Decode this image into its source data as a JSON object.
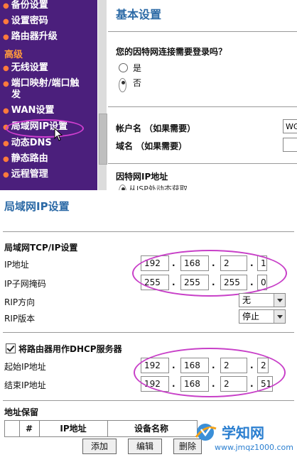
{
  "sidebar": {
    "items_top": [
      {
        "label": "备份设置"
      },
      {
        "label": "设置密码"
      },
      {
        "label": "路由器升级"
      }
    ],
    "section_advanced": "高级",
    "items_adv": [
      {
        "label": "无线设置"
      },
      {
        "label": "端口映射/端口触"
      },
      {
        "label": "发"
      },
      {
        "label": "WAN设置"
      },
      {
        "label": "局域网IP设置"
      },
      {
        "label": "动态DNS"
      },
      {
        "label": "静态路由"
      },
      {
        "label": "远程管理"
      }
    ]
  },
  "basic": {
    "title": "基本设置",
    "question": "您的因特网连接需要登录吗？",
    "opt_yes": "是",
    "opt_no": "否",
    "selected": "否",
    "account_label": "帐户名 （如果需要）",
    "account_value": "WGI",
    "domain_label": "域名 （如果需要）",
    "domain_value": "",
    "isp_title": "因特网IP地址",
    "isp_sub": "从ISP处动态获取"
  },
  "lan": {
    "title": "局域网IP设置",
    "tcpip_title": "局域网TCP/IP设置",
    "ip_label": "IP地址",
    "ip": [
      "192",
      "168",
      "2",
      "1"
    ],
    "mask_label": "IP子网掩码",
    "mask": [
      "255",
      "255",
      "255",
      "0"
    ],
    "rip_dir_label": "RIP方向",
    "rip_dir_value": "无",
    "rip_ver_label": "RIP版本",
    "rip_ver_value": "停止",
    "dhcp_label": "将路由器用作DHCP服务器",
    "dhcp_checked": true,
    "start_label": "起始IP地址",
    "start_ip": [
      "192",
      "168",
      "2",
      "2"
    ],
    "end_label": "结束IP地址",
    "end_ip": [
      "192",
      "168",
      "2",
      "51"
    ],
    "reserve_title": "地址保留",
    "reserve_cols": [
      "#",
      "IP地址",
      "设备名称"
    ],
    "buttons": {
      "add": "添加",
      "edit": "编辑",
      "delete": "删除"
    }
  },
  "watermark": {
    "line1": "学知网",
    "line2": "www.jmqz1000.com"
  },
  "colors": {
    "sidebar": "#4b1f7c",
    "title_blue": "#2c6aa6",
    "oval": "#c840c8"
  }
}
